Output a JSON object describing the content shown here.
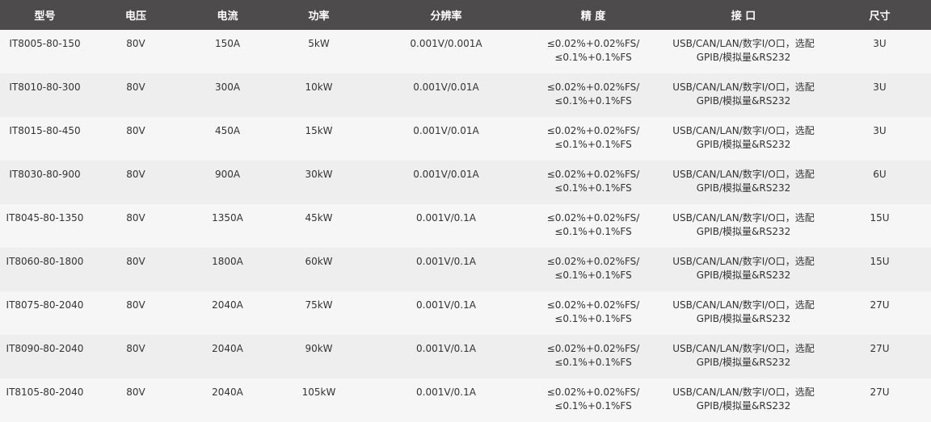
{
  "headers": [
    "型号",
    "电压",
    "电流",
    "功率",
    "分辨率",
    "精 度",
    "接 口",
    "尺寸"
  ],
  "rows": [
    {
      "model": "IT8005-80-150",
      "voltage": "80V",
      "current": "150A",
      "power": "5kW",
      "resolution": "0.001V/0.001A",
      "accuracy": [
        "≤0.02%+0.02%FS/",
        "≤0.1%+0.1%FS"
      ],
      "interface": [
        "USB/CAN/LAN/数字I/O口，选配",
        "GPIB/模拟量&RS232"
      ],
      "size": "3U"
    },
    {
      "model": "IT8010-80-300",
      "voltage": "80V",
      "current": "300A",
      "power": "10kW",
      "resolution": "0.001V/0.01A",
      "accuracy": [
        "≤0.02%+0.02%FS/",
        "≤0.1%+0.1%FS"
      ],
      "interface": [
        "USB/CAN/LAN/数字I/O口，选配",
        "GPIB/模拟量&RS232"
      ],
      "size": "3U"
    },
    {
      "model": "IT8015-80-450",
      "voltage": "80V",
      "current": "450A",
      "power": "15kW",
      "resolution": "0.001V/0.01A",
      "accuracy": [
        "≤0.02%+0.02%FS/",
        "≤0.1%+0.1%FS"
      ],
      "interface": [
        "USB/CAN/LAN/数字I/O口，选配",
        "GPIB/模拟量&RS232"
      ],
      "size": "3U"
    },
    {
      "model": "IT8030-80-900",
      "voltage": "80V",
      "current": "900A",
      "power": "30kW",
      "resolution": "0.001V/0.01A",
      "accuracy": [
        "≤0.02%+0.02%FS/",
        "≤0.1%+0.1%FS"
      ],
      "interface": [
        "USB/CAN/LAN/数字I/O口，选配",
        "GPIB/模拟量&RS232"
      ],
      "size": "6U"
    },
    {
      "model": "IT8045-80-1350",
      "voltage": "80V",
      "current": "1350A",
      "power": "45kW",
      "resolution": "0.001V/0.1A",
      "accuracy": [
        "≤0.02%+0.02%FS/",
        "≤0.1%+0.1%FS"
      ],
      "interface": [
        "USB/CAN/LAN/数字I/O口，选配",
        "GPIB/模拟量&RS232"
      ],
      "size": "15U"
    },
    {
      "model": "IT8060-80-1800",
      "voltage": "80V",
      "current": "1800A",
      "power": "60kW",
      "resolution": "0.001V/0.1A",
      "accuracy": [
        "≤0.02%+0.02%FS/",
        "≤0.1%+0.1%FS"
      ],
      "interface": [
        "USB/CAN/LAN/数字I/O口，选配",
        "GPIB/模拟量&RS232"
      ],
      "size": "15U"
    },
    {
      "model": "IT8075-80-2040",
      "voltage": "80V",
      "current": "2040A",
      "power": "75kW",
      "resolution": "0.001V/0.1A",
      "accuracy": [
        "≤0.02%+0.02%FS/",
        "≤0.1%+0.1%FS"
      ],
      "interface": [
        "USB/CAN/LAN/数字I/O口，选配",
        "GPIB/模拟量&RS232"
      ],
      "size": "27U"
    },
    {
      "model": "IT8090-80-2040",
      "voltage": "80V",
      "current": "2040A",
      "power": "90kW",
      "resolution": "0.001V/0.1A",
      "accuracy": [
        "≤0.02%+0.02%FS/",
        "≤0.1%+0.1%FS"
      ],
      "interface": [
        "USB/CAN/LAN/数字I/O口，选配",
        "GPIB/模拟量&RS232"
      ],
      "size": "27U"
    },
    {
      "model": "IT8105-80-2040",
      "voltage": "80V",
      "current": "2040A",
      "power": "105kW",
      "resolution": "0.001V/0.1A",
      "accuracy": [
        "≤0.02%+0.02%FS/",
        "≤0.1%+0.1%FS"
      ],
      "interface": [
        "USB/CAN/LAN/数字I/O口，选配",
        "GPIB/模拟量&RS232"
      ],
      "size": "27U"
    }
  ]
}
